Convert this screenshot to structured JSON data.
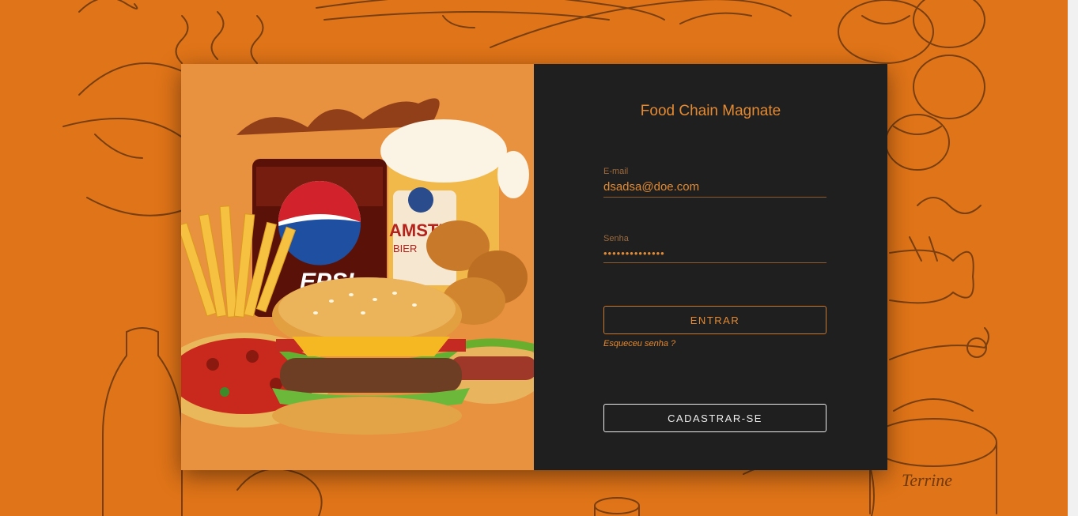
{
  "app": {
    "title": "Food Chain Magnate"
  },
  "login_form": {
    "email_label": "E-mail",
    "email_value": "dsadsa@doe.com",
    "password_label": "Senha",
    "password_value": "••••••••••••••",
    "login_button": "ENTRAR",
    "forgot_link": "Esqueceu senha ?",
    "register_button": "CADASTRAR-SE"
  },
  "hero_image": {
    "can_text": "EPSI",
    "beer_text": "AMSTE",
    "beer_subtext": "BIER"
  },
  "background": {
    "jar_label": "Terrine"
  },
  "colors": {
    "background": "#E07418",
    "panel_dark": "#1F1F1F",
    "panel_image_bg": "#E8913F",
    "accent": "#E38A32",
    "sketch": "#6E3A12"
  },
  "icons": [
    "food-sketch-pattern",
    "pepsi-logo"
  ]
}
